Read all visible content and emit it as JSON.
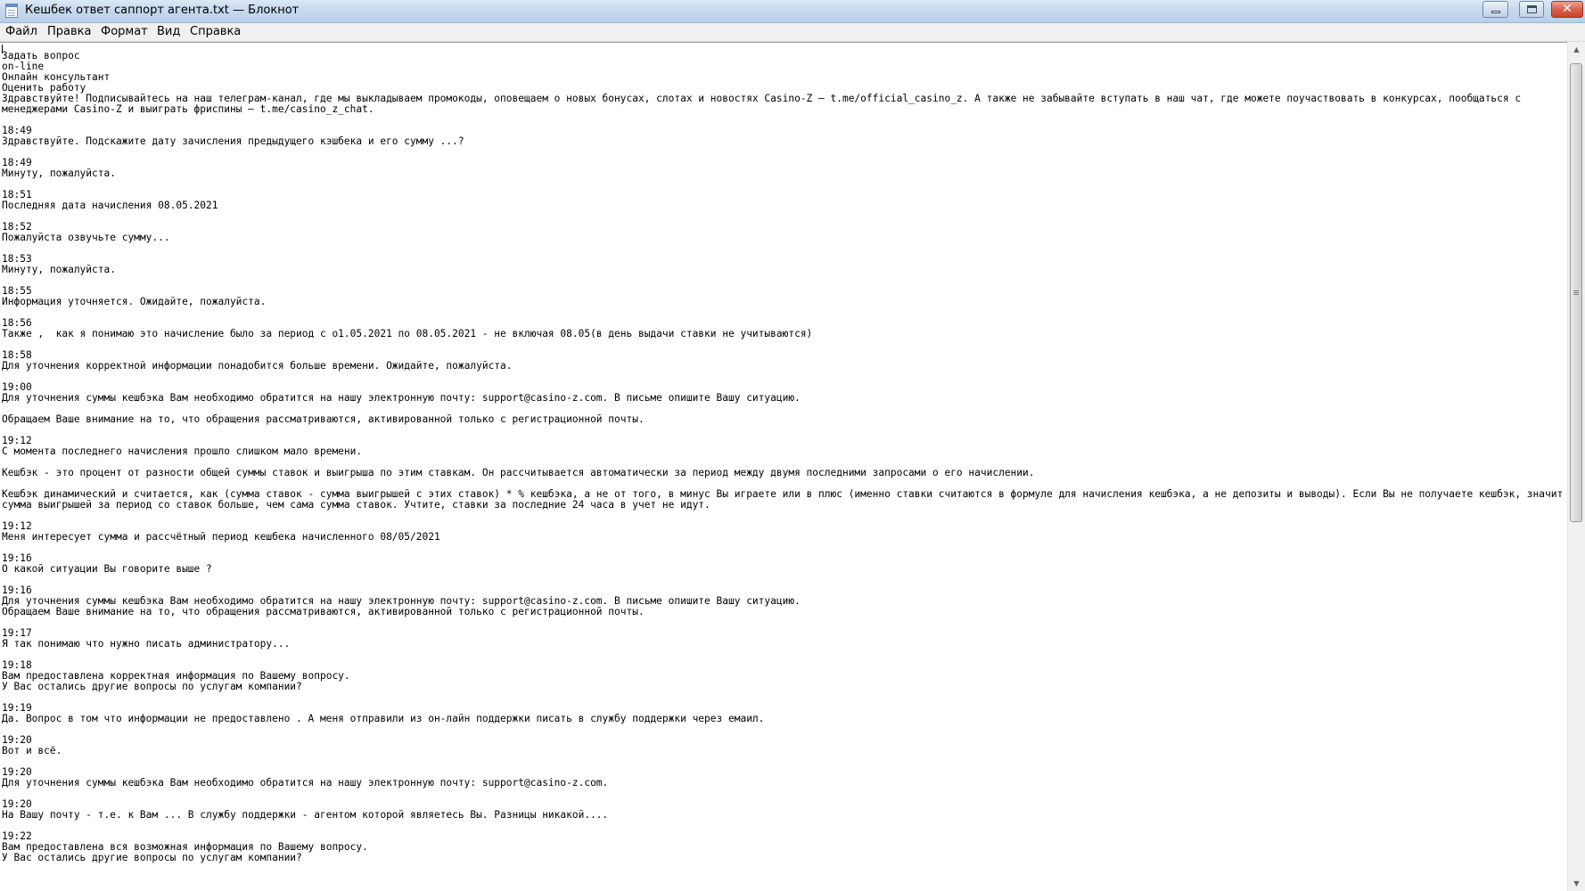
{
  "window": {
    "title": "Кешбек ответ саппорт агента.txt — Блокнот",
    "close_glyph": "✕"
  },
  "menu": {
    "items": [
      "Файл",
      "Правка",
      "Формат",
      "Вид",
      "Справка"
    ]
  },
  "editor": {
    "text": "Задать вопрос\non-line\nОнлайн консультант\nОценить работу\nЗдравствуйте! Подписывайтесь на наш телеграм-канал, где мы выкладываем промокоды, оповещаем о новых бонусах, слотах и новостях Casino-Z – t.me/official_casino_z. А также не забывайте вступать в наш чат, где можете поучаствовать в конкурсах, пообщаться с менеджерами Casino-Z и выиграть фриспины – t.me/casino_z_chat.\n\n18:49\nЗдравствуйте. Подскажите дату зачисления предыдущего кэшбека и его сумму ...?\n\n18:49\nМинуту, пожалуйста.\n\n18:51\nПоследняя дата начисления 08.05.2021\n\n18:52\nПожалуйста озвучьте сумму...\n\n18:53\nМинуту, пожалуйста.\n\n18:55\nИнформация уточняется. Ожидайте, пожалуйста.\n\n18:56\nТакже ,  как я понимаю это начисление было за период с о1.05.2021 по 08.05.2021 - не включая 08.05(в день выдачи ставки не учитываются)\n\n18:58\nДля уточнения корректной информации понадобится больше времени. Ожидайте, пожалуйста.\n\n19:00\nДля уточнения суммы кешбэка Вам необходимо обратится на нашу электронную почту: support@casino-z.com. В письме опишите Вашу ситуацию.\n\nОбращаем Ваше внимание на то, что обращения рассматриваются, активированной только с регистрационной почты.\n\n19:12\nС момента последнего начисления прошло слишком мало времени.\n\nКешбэк - это процент от разности общей суммы ставок и выигрыша по этим ставкам. Он рассчитывается автоматически за период между двумя последними запросами о его начислении.\n\nКешбэк динамический и считается, как (сумма ставок - сумма выигрышей с этих ставок) * % кешбэка, а не от того, в минус Вы играете или в плюс (именно ставки считаются в формуле для начисления кешбэка, а не депозиты и выводы). Если Вы не получаете кешбэк, значит сумма выигрышей за период со ставок больше, чем сама сумма ставок. Учтите, ставки за последние 24 часа в учет не идут.\n\n19:12\nМеня интересует сумма и рассчётный период кешбека начисленного 08/05/2021\n\n19:16\nО какой ситуации Вы говорите выше ?\n\n19:16\nДля уточнения суммы кешбэка Вам необходимо обратится на нашу электронную почту: support@casino-z.com. В письме опишите Вашу ситуацию.\nОбращаем Ваше внимание на то, что обращения рассматриваются, активированной только с регистрационной почты.\n\n19:17\nЯ так понимаю что нужно писать администратору...\n\n19:18\nВам предоставлена корректная информация по Вашему вопросу.\nУ Вас остались другие вопросы по услугам компании?\n\n19:19\nДа. Вопрос в том что информации не предоставлено . А меня отправили из он-лайн поддержки писать в службу поддержки через емаил.\n\n19:20\nВот и всё.\n\n19:20\nДля уточнения суммы кешбэка Вам необходимо обратится на нашу электронную почту: support@casino-z.com.\n\n19:20\nНа Вашу почту - т.е. к Вам ... В службу поддержки - агентом которой являетесь Вы. Разницы никакой....\n\n19:22\nВам предоставлена вся возможная информация по Вашему вопросу.\nУ Вас остались другие вопросы по услугам компании?"
  },
  "scrollbar": {
    "up_glyph": "▲",
    "down_glyph": "▼"
  }
}
